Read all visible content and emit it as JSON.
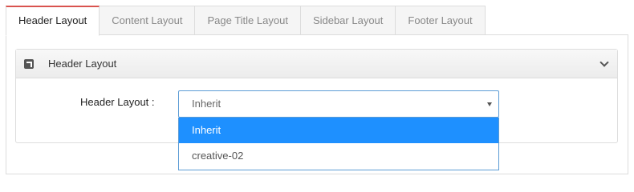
{
  "tabs": [
    {
      "label": "Header Layout",
      "active": true
    },
    {
      "label": "Content Layout",
      "active": false
    },
    {
      "label": "Page Title Layout",
      "active": false
    },
    {
      "label": "Sidebar Layout",
      "active": false
    },
    {
      "label": "Footer Layout",
      "active": false
    }
  ],
  "panel": {
    "title": "Header Layout",
    "icon": "external-link-icon",
    "toggle_icon": "chevron-down-icon"
  },
  "field": {
    "label": "Header Layout :",
    "selected_value": "Inherit",
    "options": [
      "Inherit",
      "creative-02"
    ],
    "highlighted_option": "Inherit"
  },
  "colors": {
    "active_tab_accent": "#d9534f",
    "option_highlight": "#1e90ff",
    "select_border": "#5b9bd5"
  }
}
